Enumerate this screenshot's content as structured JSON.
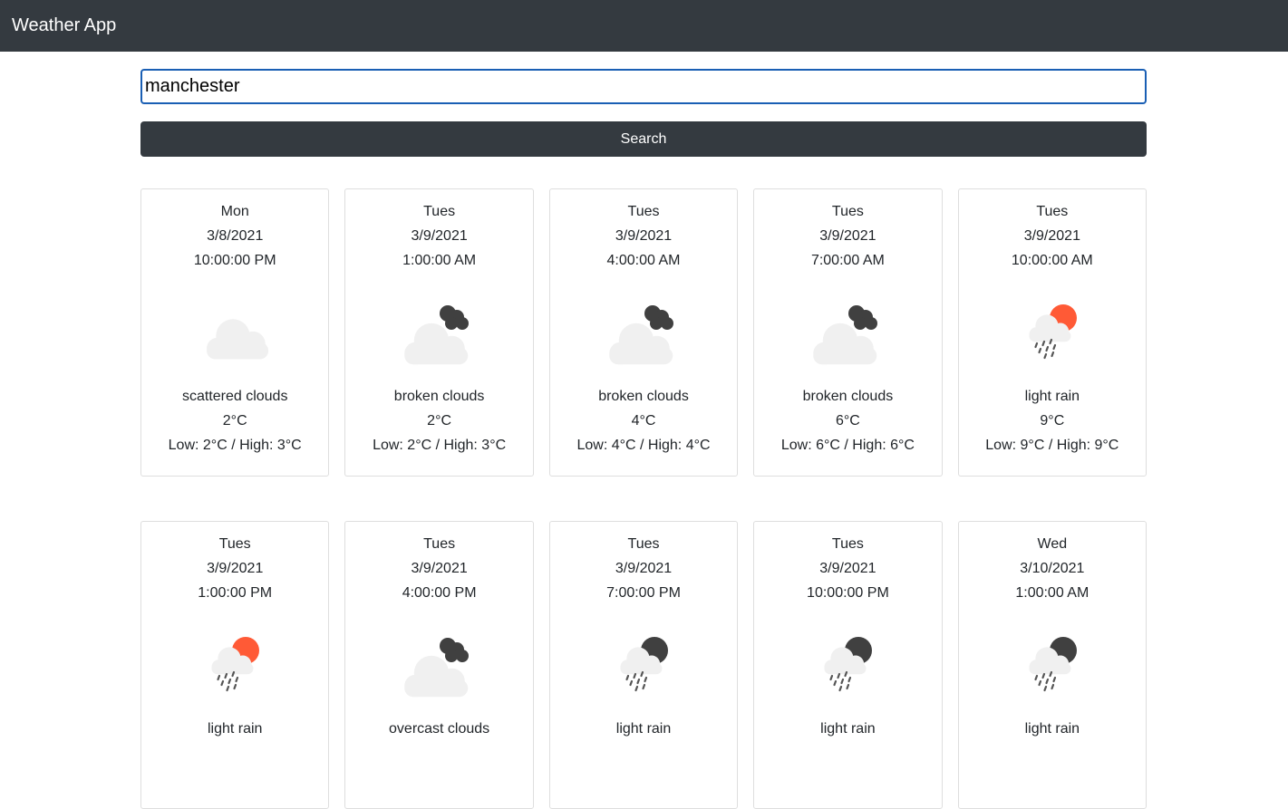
{
  "app": {
    "title": "Weather App"
  },
  "search": {
    "value": "manchester",
    "button_label": "Search"
  },
  "colors": {
    "navbar": "#343a40",
    "button": "#343a40",
    "input_border": "#1a5fb4",
    "cloud": "#f0f0f0",
    "dark_cloud": "#404040",
    "sun": "#ff5a36",
    "rain": "#555555"
  },
  "forecast": [
    {
      "day": "Mon",
      "date": "3/8/2021",
      "time": "10:00:00 PM",
      "icon": "scattered-clouds-icon",
      "desc": "scattered clouds",
      "temp": "2°C",
      "range": "Low: 2°C / High: 3°C"
    },
    {
      "day": "Tues",
      "date": "3/9/2021",
      "time": "1:00:00 AM",
      "icon": "broken-clouds-icon",
      "desc": "broken clouds",
      "temp": "2°C",
      "range": "Low: 2°C / High: 3°C"
    },
    {
      "day": "Tues",
      "date": "3/9/2021",
      "time": "4:00:00 AM",
      "icon": "broken-clouds-icon",
      "desc": "broken clouds",
      "temp": "4°C",
      "range": "Low: 4°C / High: 4°C"
    },
    {
      "day": "Tues",
      "date": "3/9/2021",
      "time": "7:00:00 AM",
      "icon": "broken-clouds-icon",
      "desc": "broken clouds",
      "temp": "6°C",
      "range": "Low: 6°C / High: 6°C"
    },
    {
      "day": "Tues",
      "date": "3/9/2021",
      "time": "10:00:00 AM",
      "icon": "light-rain-sun-icon",
      "desc": "light rain",
      "temp": "9°C",
      "range": "Low: 9°C / High: 9°C"
    },
    {
      "day": "Tues",
      "date": "3/9/2021",
      "time": "1:00:00 PM",
      "icon": "light-rain-sun-icon",
      "desc": "light rain"
    },
    {
      "day": "Tues",
      "date": "3/9/2021",
      "time": "4:00:00 PM",
      "icon": "overcast-clouds-icon",
      "desc": "overcast clouds"
    },
    {
      "day": "Tues",
      "date": "3/9/2021",
      "time": "7:00:00 PM",
      "icon": "light-rain-night-icon",
      "desc": "light rain"
    },
    {
      "day": "Tues",
      "date": "3/9/2021",
      "time": "10:00:00 PM",
      "icon": "light-rain-night-icon",
      "desc": "light rain"
    },
    {
      "day": "Wed",
      "date": "3/10/2021",
      "time": "1:00:00 AM",
      "icon": "light-rain-night-icon",
      "desc": "light rain"
    }
  ]
}
